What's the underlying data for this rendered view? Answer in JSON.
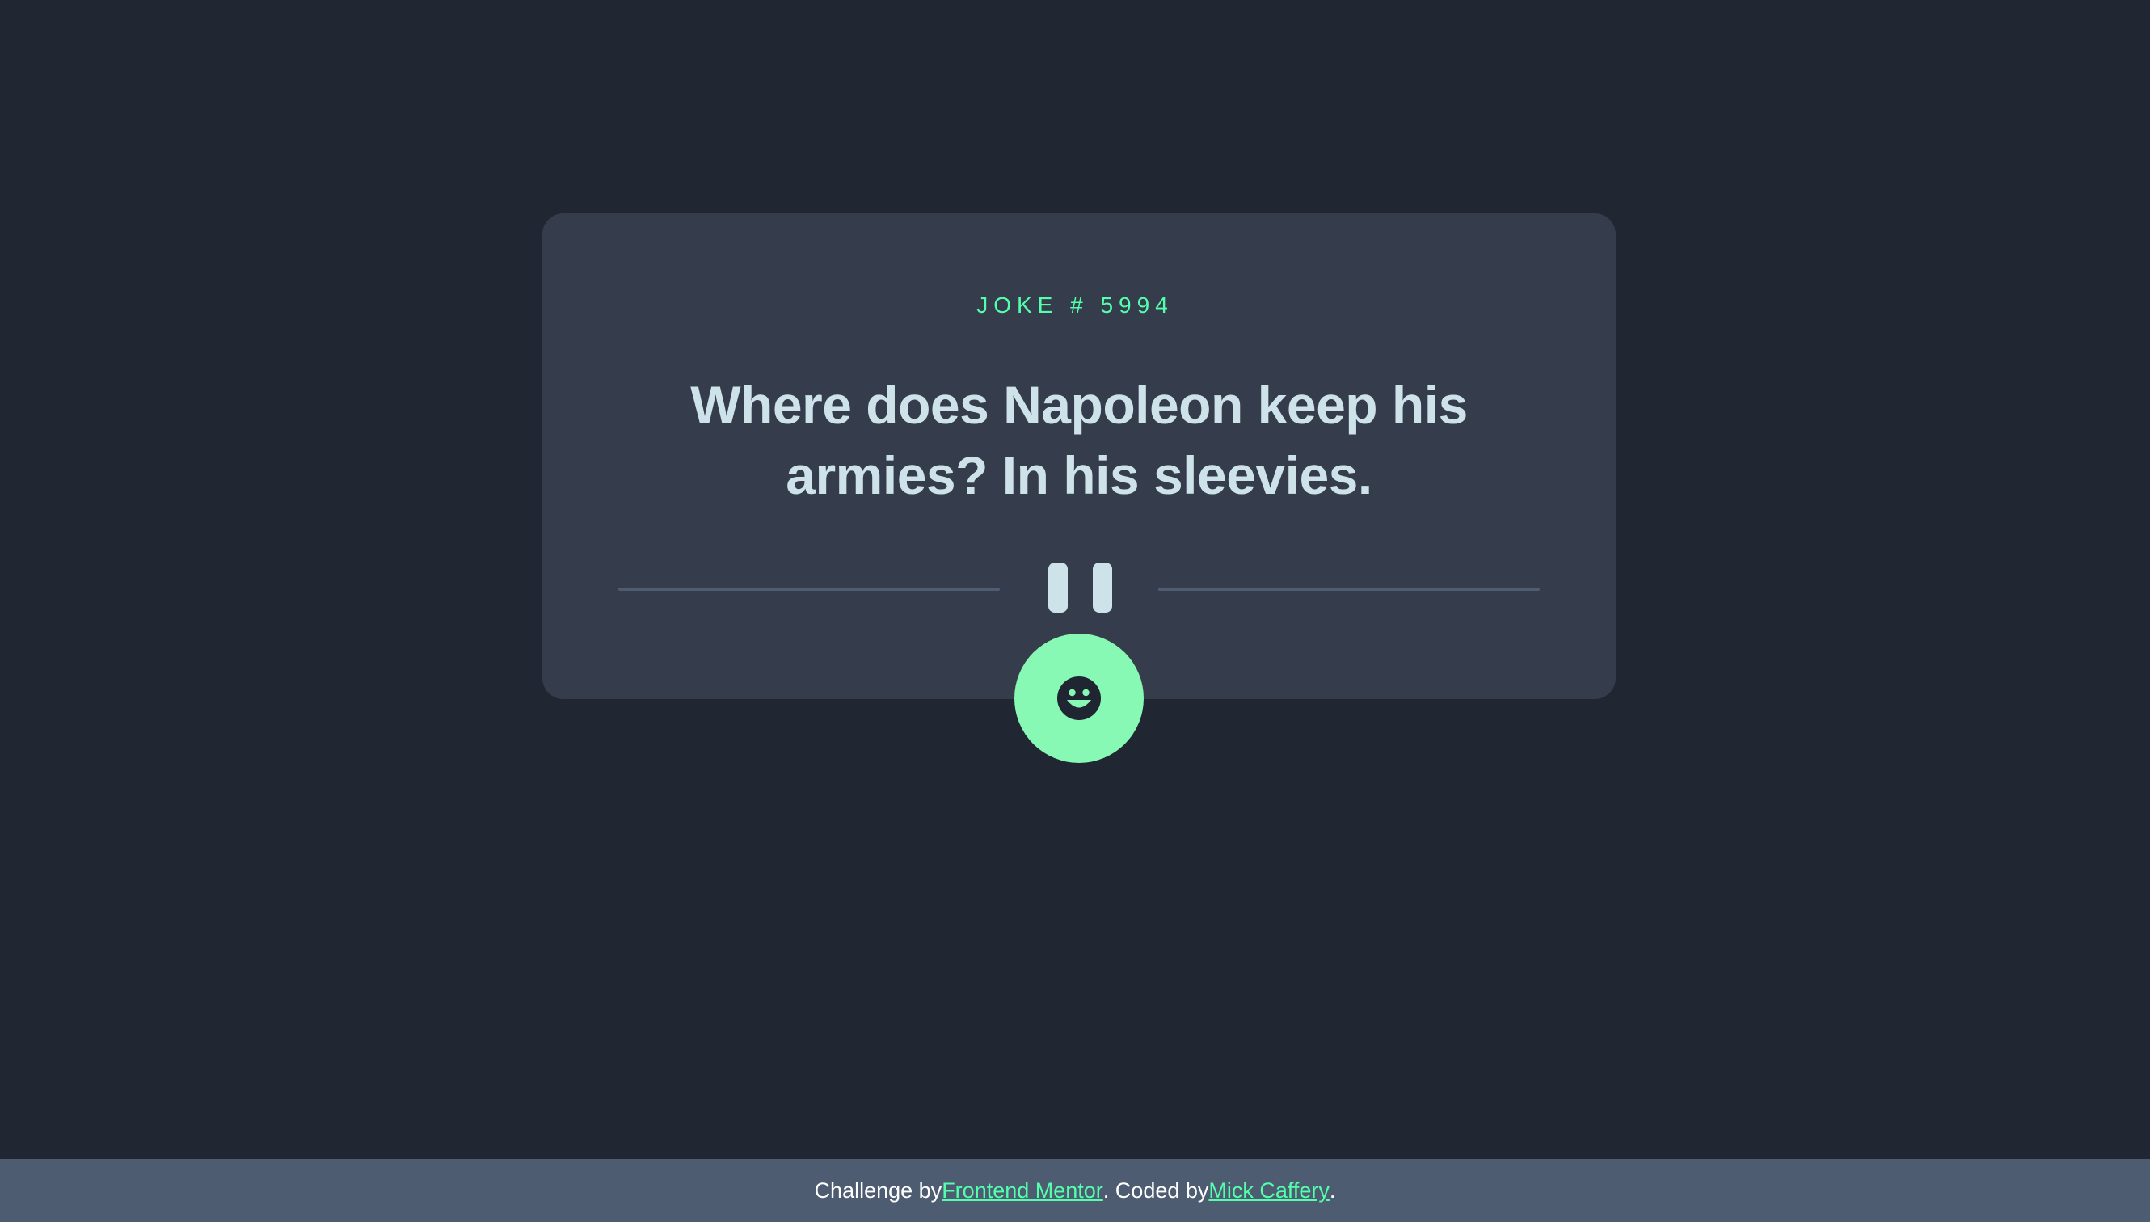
{
  "card": {
    "joke_label": "JOKE # 5994",
    "joke_text": "Where does Napoleon keep his armies? In his sleevies."
  },
  "button": {
    "icon": "smiley-face-icon"
  },
  "footer": {
    "prefix": "Challenge by ",
    "link1": "Frontend Mentor",
    "middle": ". Coded by ",
    "link2": "Mick Caffery",
    "suffix": "."
  },
  "colors": {
    "background": "#202632",
    "card": "#353c4b",
    "accent": "#53ffab",
    "button": "#87f9b4",
    "text": "#cee3e9",
    "footer": "#4d5c71"
  }
}
